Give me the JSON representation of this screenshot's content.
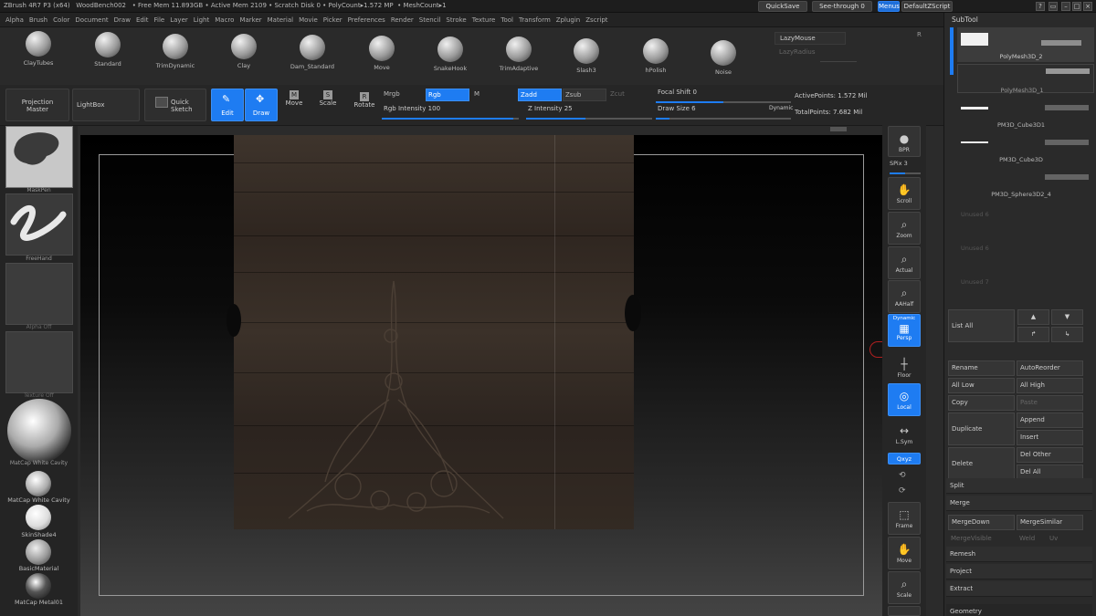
{
  "titlebar": {
    "info": "ZBrush 4R7 P3 (x64)   WoodBench002   • Free Mem 11.893GB • Active Mem 2109 • Scratch Disk 0 • PolyCount▸1.572 MP  • MeshCount▸1",
    "quicksave": "QuickSave",
    "seethrough": "See-through  0",
    "menus": "Menus",
    "script": "DefaultZScript"
  },
  "menubar": [
    "Alpha",
    "Brush",
    "Color",
    "Document",
    "Draw",
    "Edit",
    "File",
    "Layer",
    "Light",
    "Macro",
    "Marker",
    "Material",
    "Movie",
    "Picker",
    "Preferences",
    "Render",
    "Stencil",
    "Stroke",
    "Texture",
    "Tool",
    "Transform",
    "Zplugin",
    "Zscript"
  ],
  "brushes": [
    "ClayTubes",
    "Standard",
    "TrimDynamic",
    "Clay",
    "Dam_Standard",
    "Move",
    "SnakeHook",
    "TrimAdaptive",
    "Slash3",
    "hPolish",
    "Noise"
  ],
  "lazy": {
    "mouse": "LazyMouse",
    "radius": "LazyRadius",
    "r": "R"
  },
  "toolbar": {
    "projection": "Projection\nMaster",
    "lightbox": "LightBox",
    "quicksketch": "Quick\nSketch",
    "edit": "Edit",
    "draw": "Draw",
    "move": "Move",
    "scale": "Scale",
    "rotate": "Rotate",
    "mrgb": "Mrgb",
    "rgb": "Rgb",
    "m": "M",
    "zadd": "Zadd",
    "zsub": "Zsub",
    "zcut": "Zcut",
    "rgb_intensity": "Rgb Intensity 100",
    "z_intensity": "Z Intensity 25",
    "focal_shift": "Focal Shift 0",
    "draw_size": "Draw Size 6",
    "dynamic": "Dynamic",
    "active_points": "ActivePoints: 1.572 Mil",
    "total_points": "TotalPoints: 7.682 Mil"
  },
  "leftpanel": {
    "alpha_brush": "MaskPen",
    "stroke": "FreeHand",
    "alpha": "Alpha Off",
    "texture": "Texture Off",
    "material_big": "MatCap White Cavity",
    "materials": [
      "MatCap White Cavity",
      "SkinShade4",
      "BasicMaterial",
      "MatCap Metal01"
    ]
  },
  "nav": {
    "bpr": "BPR",
    "spix": "SPix 3",
    "scroll": "Scroll",
    "zoom": "Zoom",
    "actual": "Actual",
    "aahalf": "AAHalf",
    "dynamic": "Dynamic",
    "persp": "Persp",
    "floor": "Floor",
    "local": "Local",
    "lsym": "L.Sym",
    "xyz": "Qxyz",
    "frame": "Frame",
    "move": "Move",
    "scale": "Scale"
  },
  "subtool": {
    "title": "SubTool",
    "items": [
      "PolyMesh3D_2",
      "PolyMesh3D_1",
      "PM3D_Cube3D1",
      "PM3D_Cube3D",
      "PM3D_Sphere3D2_4",
      "Unused 6",
      "Unused 6",
      "Unused 7"
    ],
    "list_all": "List All",
    "rename": "Rename",
    "autoreorder": "AutoReorder",
    "all_low": "All Low",
    "all_high": "All High",
    "copy": "Copy",
    "paste": "Paste",
    "duplicate": "Duplicate",
    "append": "Append",
    "insert": "Insert",
    "delete": "Delete",
    "del_other": "Del Other",
    "del_all": "Del All",
    "split": "Split",
    "merge": "Merge",
    "mergedown": "MergeDown",
    "mergesimilar": "MergeSimilar",
    "mergevisible": "MergeVisible",
    "weld": "Weld",
    "uv": "Uv",
    "remesh": "Remesh",
    "project": "Project",
    "extract": "Extract",
    "geometry": "Geometry"
  }
}
